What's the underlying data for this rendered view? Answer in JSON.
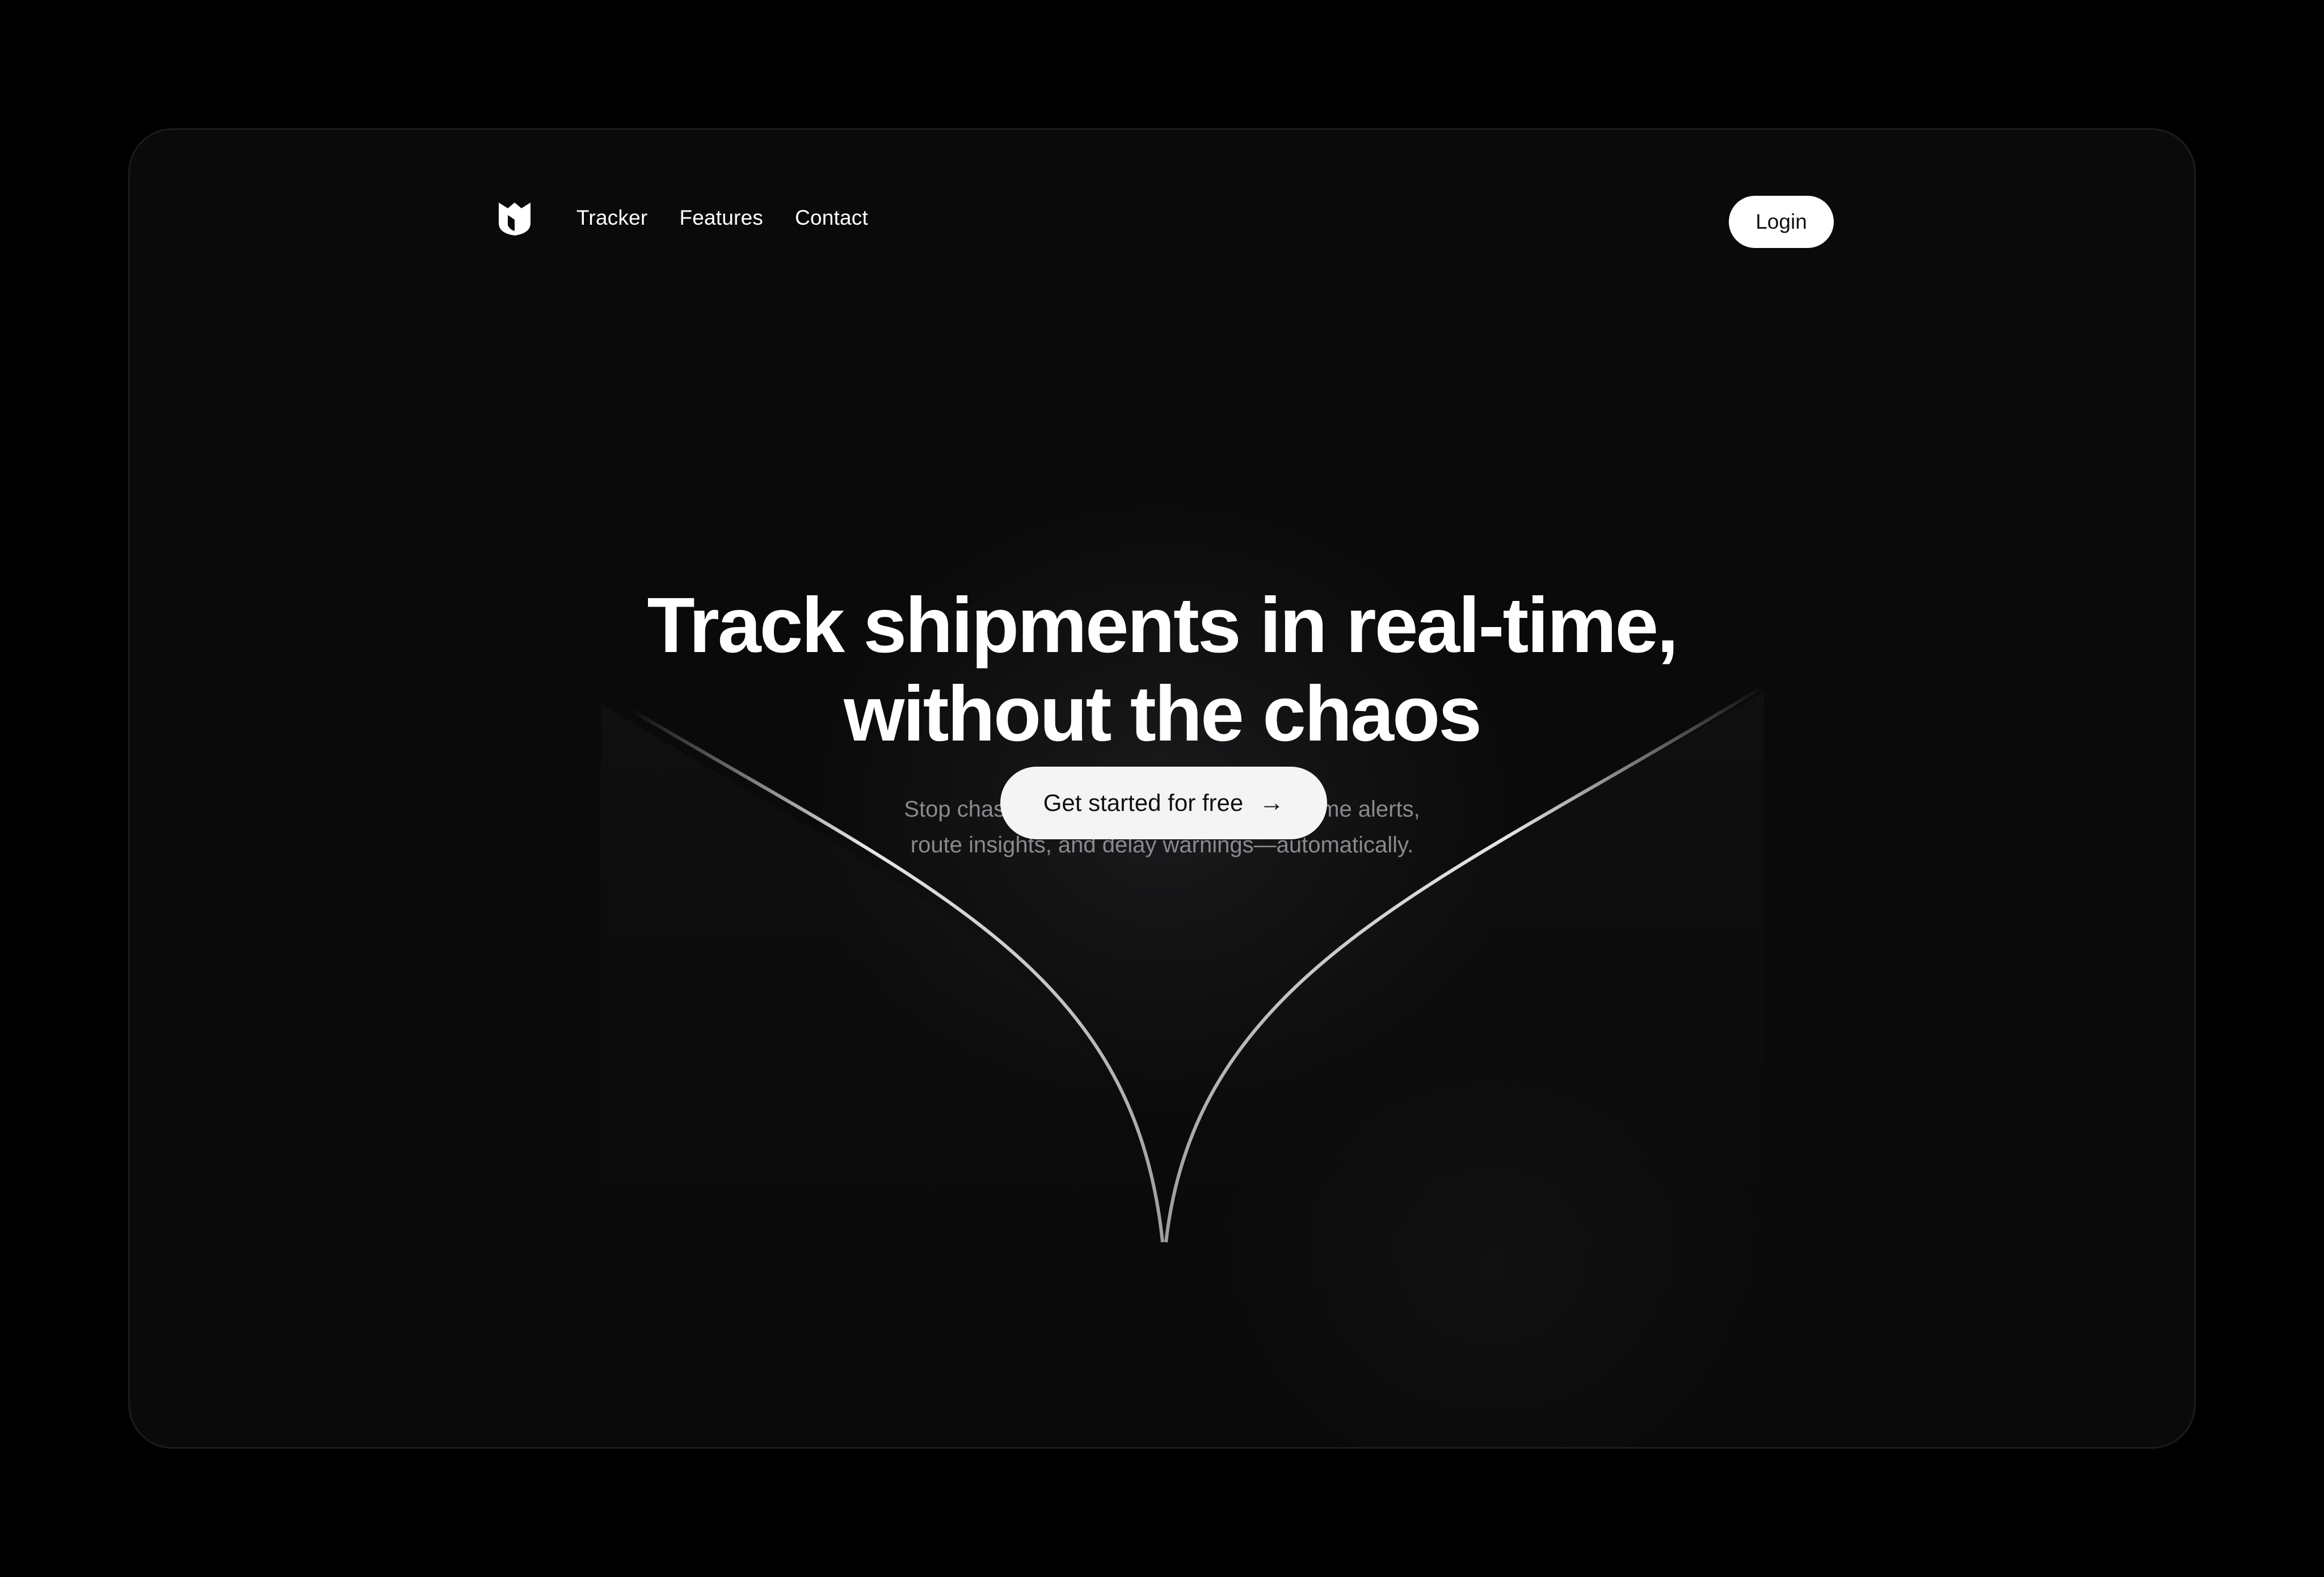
{
  "nav": {
    "logo_icon": "shield-logo-icon",
    "links": [
      "Tracker",
      "Features",
      "Contact"
    ],
    "login_label": "Login"
  },
  "hero": {
    "title_line1": "Track shipments in real-time,",
    "title_line2": "without the chaos",
    "subtitle_line1": "Stop chasing updates. Start getting real-time alerts,",
    "subtitle_line2": "route insights, and delay warnings—automatically.",
    "cta_label": "Get started for free",
    "cta_icon": "arrow-right-icon"
  },
  "colors": {
    "page_background": "#000000",
    "frame_background": "#0a0a0a",
    "text_primary": "#ffffff",
    "text_muted": "#8a8a8e",
    "button_background": "#f4f4f4"
  }
}
